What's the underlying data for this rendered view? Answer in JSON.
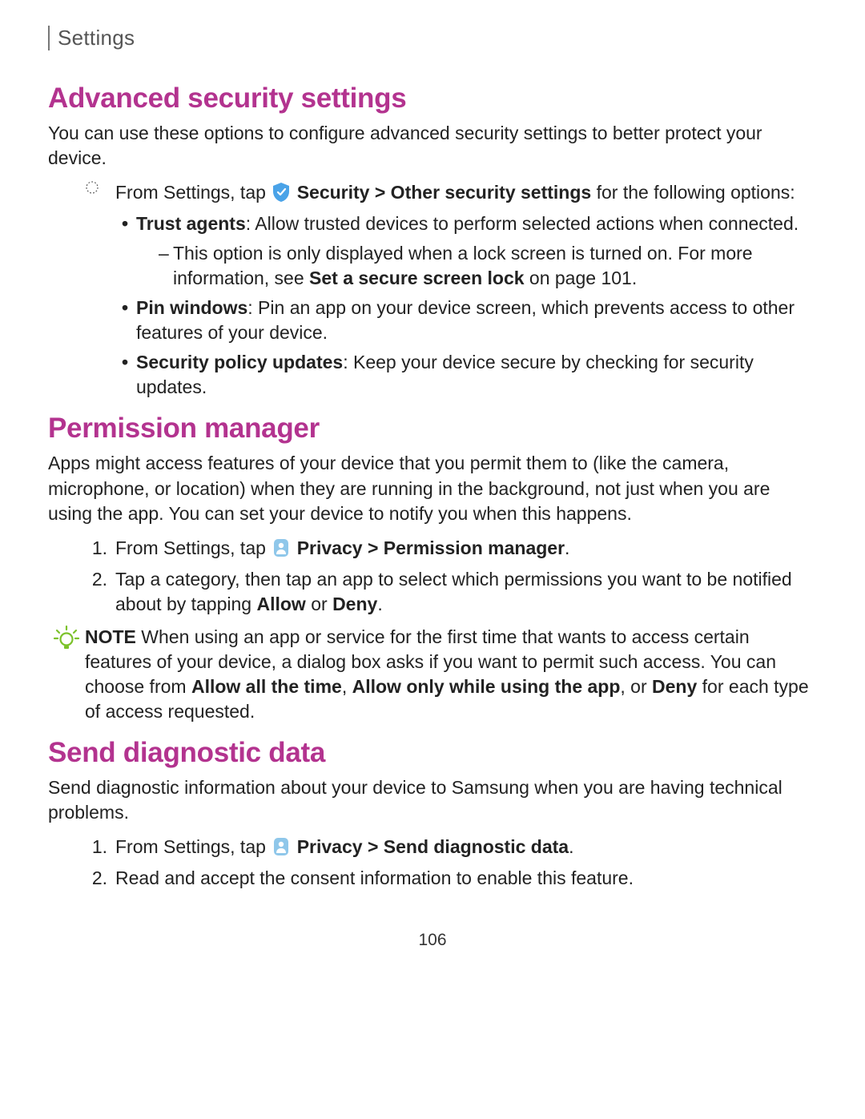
{
  "breadcrumb": "Settings",
  "page_number": "106",
  "sec1": {
    "title": "Advanced security settings",
    "intro": "You can use these options to configure advanced security settings to better protect your device.",
    "lead_pre": "From Settings, tap ",
    "lead_bold": "Security > Other security settings",
    "lead_post": " for the following options:",
    "b1_bold": "Trust agents",
    "b1_rest": ": Allow trusted devices to perform selected actions when connected.",
    "b1_sub_pre": "This option is only displayed when a lock screen is turned on. For more information, see ",
    "b1_sub_link": "Set a secure screen lock",
    "b1_sub_post": " on page 101.",
    "b2_bold": "Pin windows",
    "b2_rest": ": Pin an app on your device screen, which prevents access to other features of your device.",
    "b3_bold": "Security policy updates",
    "b3_rest": ": Keep your device secure by checking for security updates."
  },
  "sec2": {
    "title": "Permission manager",
    "intro": "Apps might access features of your device that you permit them to (like the camera, microphone, or location) when they are running in the background, not just when you are using the app. You can set your device to notify you when this happens.",
    "s1_num": "1.",
    "s1_pre": "From Settings, tap ",
    "s1_bold": "Privacy > Permission manager",
    "s1_post": ".",
    "s2_num": "2.",
    "s2_pre": "Tap a category, then tap an app to select which permissions you want to be notified about by tapping ",
    "s2_allow": "Allow",
    "s2_or": " or ",
    "s2_deny": "Deny",
    "s2_post": ".",
    "note_label": "NOTE",
    "note_pre": "  When using an app or service for the first time that wants to access certain features of your device, a dialog box asks if you want to permit such access. You can choose from ",
    "note_o1": "Allow all the time",
    "note_c1": ", ",
    "note_o2": "Allow only while using the app",
    "note_c2": ", or ",
    "note_o3": "Deny",
    "note_post": " for each type of access requested."
  },
  "sec3": {
    "title": "Send diagnostic data",
    "intro": "Send diagnostic information about your device to Samsung when you are having technical problems.",
    "s1_num": "1.",
    "s1_pre": "From Settings, tap ",
    "s1_bold": "Privacy > Send diagnostic data",
    "s1_post": ".",
    "s2_num": "2.",
    "s2_text": "Read and accept the consent information to enable this feature."
  }
}
